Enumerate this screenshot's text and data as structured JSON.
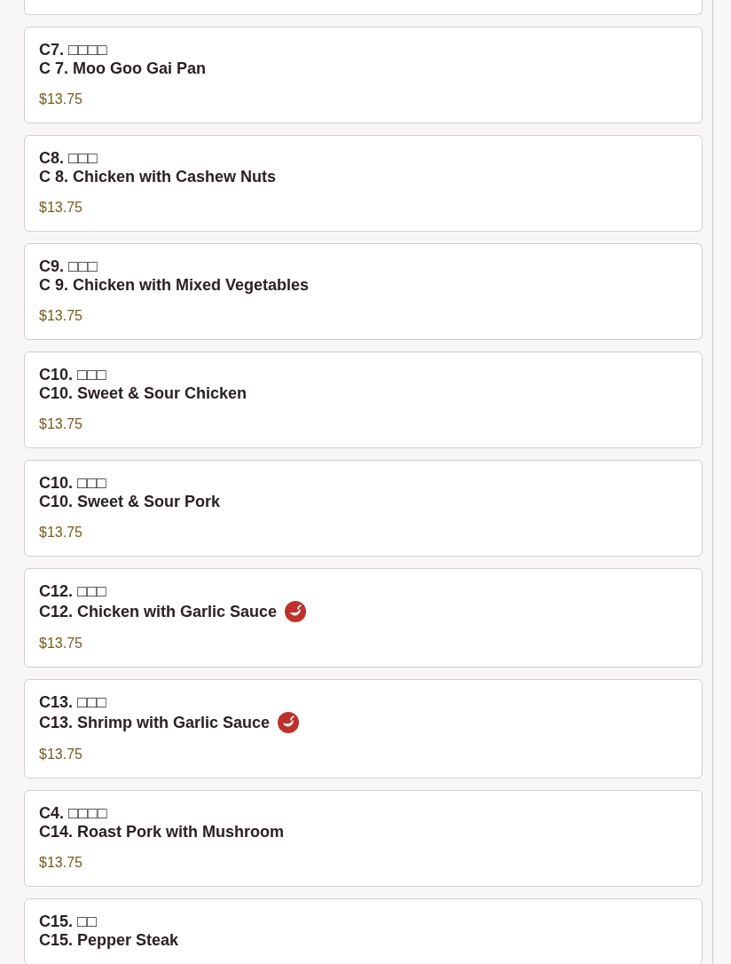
{
  "items": [
    {
      "code_name": "C7. □□□□",
      "name": "C 7. Moo Goo Gai Pan",
      "spicy": false,
      "price": "$13.75"
    },
    {
      "code_name": "C8. □□□",
      "name": "C 8. Chicken with Cashew Nuts",
      "spicy": false,
      "price": "$13.75"
    },
    {
      "code_name": "C9. □□□",
      "name": "C 9. Chicken with Mixed Vegetables",
      "spicy": false,
      "price": "$13.75"
    },
    {
      "code_name": "C10. □□□",
      "name": "C10. Sweet & Sour Chicken",
      "spicy": false,
      "price": "$13.75"
    },
    {
      "code_name": "C10. □□□",
      "name": "C10. Sweet & Sour Pork",
      "spicy": false,
      "price": "$13.75"
    },
    {
      "code_name": "C12. □□□",
      "name": "C12. Chicken with Garlic Sauce",
      "spicy": true,
      "price": "$13.75"
    },
    {
      "code_name": "C13. □□□",
      "name": "C13. Shrimp with Garlic Sauce",
      "spicy": true,
      "price": "$13.75"
    },
    {
      "code_name": "C4. □□□□",
      "name": "C14. Roast Pork with Mushroom",
      "spicy": false,
      "price": "$13.75"
    },
    {
      "code_name": "C15. □□",
      "name": "C15. Pepper Steak",
      "spicy": false
    }
  ]
}
